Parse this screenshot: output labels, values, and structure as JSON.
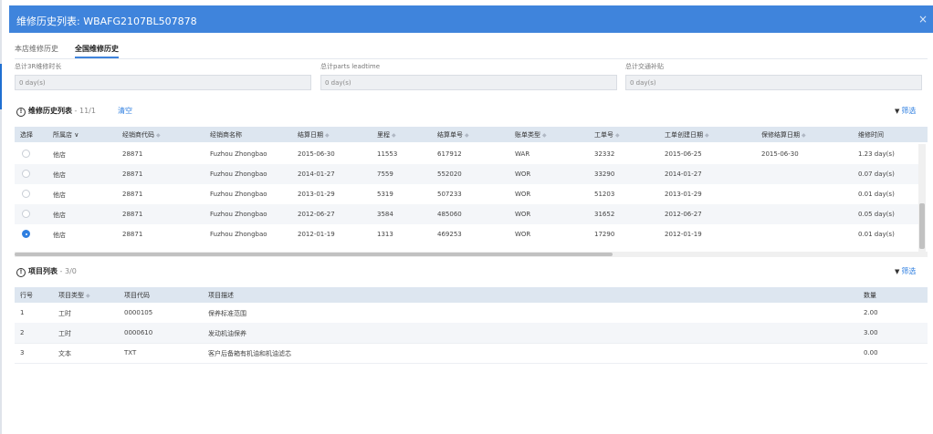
{
  "window": {
    "title": "维修历史列表: WBAFG2107BL507878",
    "close_glyph": "×"
  },
  "tabs": [
    {
      "label": "本店维修历史",
      "active": false
    },
    {
      "label": "全国维修历史",
      "active": true
    }
  ],
  "summary_fields": [
    {
      "label": "总计3R维修时长",
      "value": "0 day(s)"
    },
    {
      "label": "总计parts leadtime",
      "value": "0 day(s)"
    },
    {
      "label": "总计交通补贴",
      "value": "0 day(s)"
    }
  ],
  "history": {
    "title": "维修历史列表",
    "count": " - 11/1",
    "clear_label": "清空",
    "filter_label": "筛选",
    "columns": [
      "选择",
      "所属店",
      "经销商代码",
      "经销商名称",
      "结算日期",
      "里程",
      "结算单号",
      "账单类型",
      "工单号",
      "工单创建日期",
      "保修结算日期",
      "维修时间"
    ],
    "store_dropdown_icon": "chevron-down-icon",
    "rows": [
      {
        "selected": false,
        "store": "他店",
        "dealer_code": "28871",
        "dealer_name": "Fuzhou Zhongbao",
        "settle_date": "2015-06-30",
        "mileage": "11553",
        "settle_no": "617912",
        "bill_type": "WAR",
        "order_no": "32332",
        "order_date": "2015-06-25",
        "warranty_date": "2015-06-30",
        "repair_time": "1.23 day(s)"
      },
      {
        "selected": false,
        "store": "他店",
        "dealer_code": "28871",
        "dealer_name": "Fuzhou Zhongbao",
        "settle_date": "2014-01-27",
        "mileage": "7559",
        "settle_no": "552020",
        "bill_type": "WOR",
        "order_no": "33290",
        "order_date": "2014-01-27",
        "warranty_date": "",
        "repair_time": "0.07 day(s)"
      },
      {
        "selected": false,
        "store": "他店",
        "dealer_code": "28871",
        "dealer_name": "Fuzhou Zhongbao",
        "settle_date": "2013-01-29",
        "mileage": "5319",
        "settle_no": "507233",
        "bill_type": "WOR",
        "order_no": "51203",
        "order_date": "2013-01-29",
        "warranty_date": "",
        "repair_time": "0.01 day(s)"
      },
      {
        "selected": false,
        "store": "他店",
        "dealer_code": "28871",
        "dealer_name": "Fuzhou Zhongbao",
        "settle_date": "2012-06-27",
        "mileage": "3584",
        "settle_no": "485060",
        "bill_type": "WOR",
        "order_no": "31652",
        "order_date": "2012-06-27",
        "warranty_date": "",
        "repair_time": "0.05 day(s)"
      },
      {
        "selected": true,
        "store": "他店",
        "dealer_code": "28871",
        "dealer_name": "Fuzhou Zhongbao",
        "settle_date": "2012-01-19",
        "mileage": "1313",
        "settle_no": "469253",
        "bill_type": "WOR",
        "order_no": "17290",
        "order_date": "2012-01-19",
        "warranty_date": "",
        "repair_time": "0.01 day(s)"
      }
    ]
  },
  "items": {
    "title": "项目列表",
    "count": " - 3/0",
    "filter_label": "筛选",
    "columns": [
      "行号",
      "项目类型",
      "项目代码",
      "项目描述",
      "数量"
    ],
    "rows": [
      {
        "line": "1",
        "type": "工时",
        "code": "0000105",
        "desc": "保养标准范围",
        "qty": "2.00"
      },
      {
        "line": "2",
        "type": "工时",
        "code": "0000610",
        "desc": "发动机油保养",
        "qty": "3.00"
      },
      {
        "line": "3",
        "type": "文本",
        "code": "TXT",
        "desc": "客户后备箱有机油和机油滤芯",
        "qty": "0.00"
      }
    ]
  },
  "colors": {
    "titlebar": "#3f84dc",
    "accent": "#2f7fe0",
    "header_row": "#dde6f0"
  }
}
